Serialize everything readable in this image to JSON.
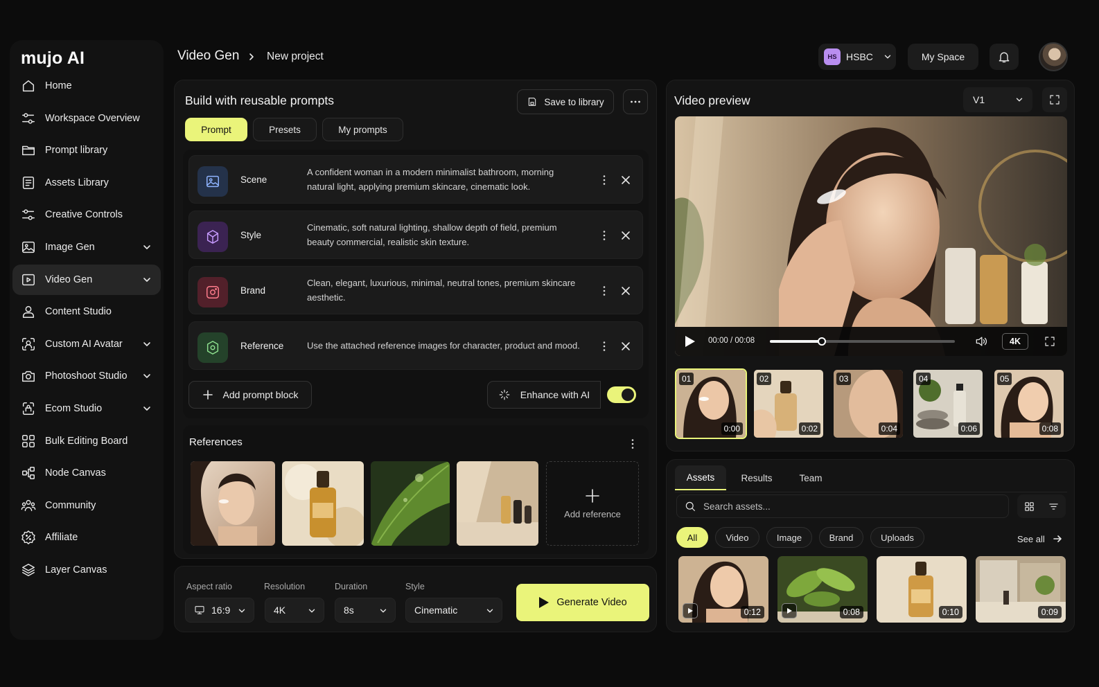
{
  "app": {
    "logo": "mujo AI"
  },
  "sidebar": {
    "items": [
      {
        "label": "Home",
        "icon": "home-icon"
      },
      {
        "label": "Workspace Overview",
        "icon": "sliders-icon"
      },
      {
        "label": "Prompt library",
        "icon": "folder-icon"
      },
      {
        "label": "Assets Library",
        "icon": "list-icon"
      },
      {
        "label": "Creative Controls",
        "icon": "sliders-icon"
      },
      {
        "label": "Image Gen",
        "icon": "image-icon",
        "expandable": true
      },
      {
        "label": "Video Gen",
        "icon": "video-icon",
        "expandable": true,
        "active": true
      },
      {
        "label": "Content Studio",
        "icon": "user-icon"
      },
      {
        "label": "Custom AI Avatar",
        "icon": "avatar-scan-icon",
        "expandable": true
      },
      {
        "label": "Photoshoot Studio",
        "icon": "camera-icon",
        "expandable": true
      },
      {
        "label": "Ecom Studio",
        "icon": "bag-icon",
        "expandable": true
      },
      {
        "label": "Bulk Editing Board",
        "icon": "grid-icon"
      },
      {
        "label": "Node Canvas",
        "icon": "nodes-icon"
      },
      {
        "label": "Community",
        "icon": "community-icon"
      },
      {
        "label": "Affiliate",
        "icon": "percent-icon"
      },
      {
        "label": "Layer Canvas",
        "icon": "layers-icon"
      }
    ]
  },
  "header": {
    "breadcrumb": [
      "Video Gen",
      "New project"
    ],
    "org_badge": "HS",
    "org_name": "HSBC",
    "my_space": "My Space"
  },
  "build": {
    "title": "Build with reusable prompts",
    "save_label": "Save to library",
    "tabs": [
      "Prompt",
      "Presets",
      "My prompts"
    ],
    "blocks": [
      {
        "name": "Scene",
        "text": "A confident woman in a modern minimalist bathroom, morning natural light, applying premium skincare, cinematic look.",
        "color": "#24324a",
        "icon": "image-icon"
      },
      {
        "name": "Style",
        "text": "Cinematic, soft natural lighting, shallow depth of field, premium beauty commercial, realistic skin texture.",
        "color": "#3b2352",
        "icon": "cube-icon"
      },
      {
        "name": "Brand",
        "text": "Clean, elegant, luxurious, minimal, neutral tones, premium skincare aesthetic.",
        "color": "#52202a",
        "icon": "brand-icon"
      },
      {
        "name": "Reference",
        "text": "Use the attached reference images for character, product and mood.",
        "color": "#24422a",
        "icon": "reference-icon"
      }
    ],
    "add_block": "Add prompt block",
    "enhance": "Enhance with AI",
    "enhance_on": true
  },
  "references": {
    "title": "References",
    "add_label": "Add reference"
  },
  "settings": {
    "aspect_label": "Aspect ratio",
    "aspect_value": "16:9",
    "resolution_label": "Resolution",
    "resolution_value": "4K",
    "duration_label": "Duration",
    "duration_value": "8s",
    "style_label": "Style",
    "style_value": "Cinematic",
    "generate": "Generate Video"
  },
  "preview": {
    "title": "Video preview",
    "version": "V1",
    "time": "00:00 / 00:08",
    "progress": 0.28,
    "quality": "4K",
    "frames": [
      {
        "num": "01",
        "time": "0:00"
      },
      {
        "num": "02",
        "time": "0:02"
      },
      {
        "num": "03",
        "time": "0:04"
      },
      {
        "num": "04",
        "time": "0:06"
      },
      {
        "num": "05",
        "time": "0:08"
      }
    ]
  },
  "assets": {
    "tabs": [
      "Assets",
      "Results",
      "Team"
    ],
    "search_placeholder": "Search assets...",
    "filters": [
      "All",
      "Video",
      "Image",
      "Brand",
      "Uploads"
    ],
    "see_all": "See all",
    "items": [
      {
        "duration": "0:12",
        "video": true
      },
      {
        "duration": "0:08",
        "video": true
      },
      {
        "duration": "0:10",
        "video": false
      },
      {
        "duration": "0:09",
        "video": false
      }
    ]
  },
  "colors": {
    "accent": "#eaf47a",
    "background": "#0c0c0c",
    "panel": "#141414"
  }
}
